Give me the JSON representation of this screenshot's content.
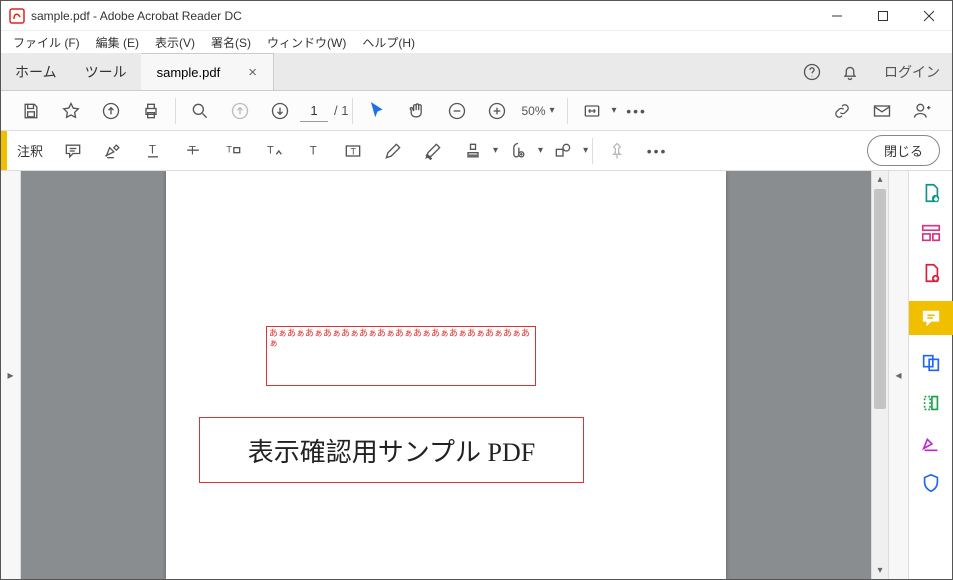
{
  "window": {
    "title": "sample.pdf - Adobe Acrobat Reader DC"
  },
  "menu": {
    "file": "ファイル (F)",
    "edit": "編集 (E)",
    "view": "表示(V)",
    "sign": "署名(S)",
    "window": "ウィンドウ(W)",
    "help": "ヘルプ(H)"
  },
  "tabs": {
    "home": "ホーム",
    "tool": "ツール",
    "document": "sample.pdf",
    "login": "ログイン"
  },
  "toolbar": {
    "page_current": "1",
    "page_total": "/ 1",
    "zoom": "50%"
  },
  "annotation": {
    "label": "注釈",
    "close": "閉じる"
  },
  "document": {
    "comment_text": "あぁあぁあぁあぁあぁあぁあぁあぁあぁあぁあぁあぁあぁあぁあぁ",
    "heading": "表示確認用サンプル PDF"
  }
}
